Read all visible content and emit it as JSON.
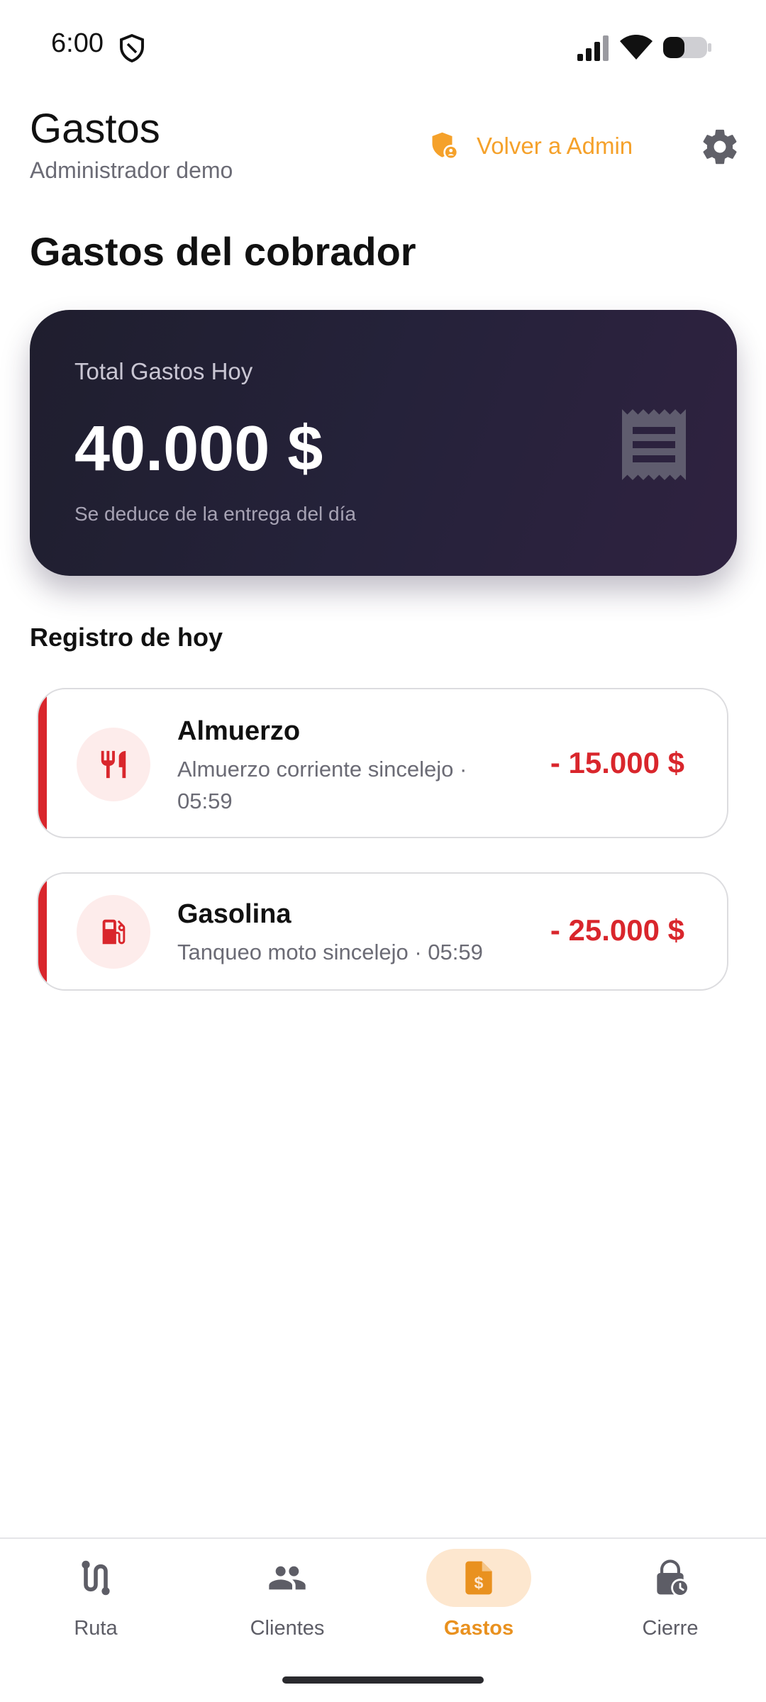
{
  "status_bar": {
    "time": "6:00",
    "icons": [
      "shield-icon",
      "signal-icon",
      "wifi-icon",
      "battery-icon"
    ]
  },
  "header": {
    "title": "Gastos",
    "subtitle": "Administrador demo",
    "back_admin_label": "Volver a Admin",
    "back_admin_icon": "admin-shield-icon",
    "settings_icon": "gear-icon"
  },
  "section_title": "Gastos del cobrador",
  "summary": {
    "label": "Total Gastos Hoy",
    "amount": "40.000 $",
    "note": "Se deduce de la entrega del día",
    "icon": "receipt-icon"
  },
  "registro": {
    "title": "Registro de hoy",
    "items": [
      {
        "name": "Almuerzo",
        "description": "Almuerzo corriente sincelejo · 05:59",
        "amount": "- 15.000 $",
        "icon": "utensils-icon"
      },
      {
        "name": "Gasolina",
        "description": "Tanqueo moto sincelejo · 05:59",
        "amount": "- 25.000 $",
        "icon": "gas-pump-icon"
      }
    ]
  },
  "nav": {
    "items": [
      {
        "label": "Ruta",
        "icon": "route-icon",
        "active": false
      },
      {
        "label": "Clientes",
        "icon": "people-icon",
        "active": false
      },
      {
        "label": "Gastos",
        "icon": "expense-doc-icon",
        "active": true
      },
      {
        "label": "Cierre",
        "icon": "lock-clock-icon",
        "active": false
      }
    ]
  },
  "colors": {
    "accent_orange": "#f5a12a",
    "danger_red": "#d9262c",
    "card_dark": "#22203a",
    "nav_active_bg": "#fde7cf"
  }
}
